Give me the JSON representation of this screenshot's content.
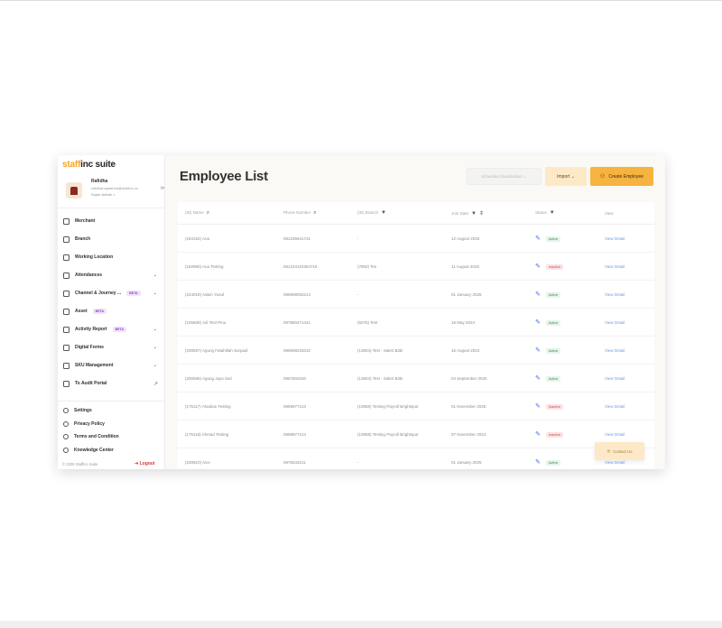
{
  "brand": {
    "logo_part1": "staff",
    "logo_part2": "inc suite",
    "accent": "#f6a623"
  },
  "user": {
    "name": "Rafidha",
    "email": "rafidharuqaiahna@staffinc.co",
    "role": "Super Admin >"
  },
  "sidebar": {
    "items": [
      {
        "label": "Merchant",
        "icon": "store-icon"
      },
      {
        "label": "Branch",
        "icon": "building-icon"
      },
      {
        "label": "Working Location",
        "icon": "building-icon"
      },
      {
        "label": "Attendances",
        "icon": "clipboard-icon",
        "chevron": "⌄"
      },
      {
        "label": "Channel & Journey ...",
        "icon": "store-icon",
        "badge": "BETA",
        "chevron": "⌄"
      },
      {
        "label": "Asset",
        "icon": "asset-icon",
        "badge": "BETA"
      },
      {
        "label": "Activity Report",
        "icon": "chart-icon",
        "badge": "BETA",
        "chevron": "⌄"
      },
      {
        "label": "Digital Forms",
        "icon": "form-icon",
        "chevron": "⌄"
      },
      {
        "label": "SKU Management",
        "icon": "box-icon",
        "chevron": "⌄"
      },
      {
        "label": "To Audit Portal",
        "icon": "portal-icon",
        "external": "↗"
      }
    ],
    "bottom_items": [
      {
        "label": "Settings",
        "icon": "gear-icon"
      },
      {
        "label": "Privacy Policy",
        "icon": "shield-icon"
      },
      {
        "label": "Terms and Condition",
        "icon": "document-icon"
      },
      {
        "label": "Knowledge Center",
        "icon": "monitor-icon"
      }
    ],
    "copyright": "© 2026 Staffinc Suite",
    "logout": "Logout"
  },
  "main": {
    "title": "Employee List",
    "scheduled_btn": "Scheduled Deactivation ⌄",
    "import_btn": "Import ⌄",
    "create_btn": "Create Employee",
    "contact_btn": "Contact Us"
  },
  "table": {
    "headers": [
      "(ID) Name",
      "Phone Number",
      "(ID) Branch",
      "Join Date",
      "Status",
      "View"
    ],
    "rows": [
      {
        "name": "(184154) Ana",
        "phone": "081236641741",
        "branch": "-",
        "join": "12 August 2025",
        "status": "Active",
        "view": "View Detail"
      },
      {
        "name": "(182990) Ana Testing",
        "phone": "081234102364718",
        "branch": "(7893) Tes",
        "join": "11 August 2025",
        "status": "Inactive",
        "view": "View Detail"
      },
      {
        "name": "(224019) Adam Yusuf",
        "phone": "089508093214",
        "branch": "-",
        "join": "01 January 2026",
        "status": "Active",
        "view": "View Detail"
      },
      {
        "name": "(105608) Adi Test Pinu",
        "phone": "087880471441",
        "branch": "(5076) Test",
        "join": "19 May 2024",
        "status": "Active",
        "view": "View Detail"
      },
      {
        "name": "(200597) Agung Fatahillah Surpadi",
        "phone": "089588233010",
        "branch": "(13604) Test - Sales B2B",
        "join": "15 August 2024",
        "status": "Active",
        "view": "View Detail"
      },
      {
        "name": "(200596) Agung Jaya Sari",
        "phone": "0857803150",
        "branch": "(13604) Test - Sales B2B",
        "join": "04 September 2025",
        "status": "Active",
        "view": "View Detail"
      },
      {
        "name": "(175117) Ahadian Testing",
        "phone": "0899977123",
        "branch": "(10658) Testing Payroll Brightspot",
        "join": "01 November 2025",
        "status": "Inactive",
        "view": "View Detail"
      },
      {
        "name": "(175118) Ahmad Testing",
        "phone": "0899977124",
        "branch": "(10658) Testing Payroll Brightspot",
        "join": "07 November 2024",
        "status": "Inactive",
        "view": "View Detail"
      },
      {
        "name": "(230810) Aice",
        "phone": "0876543211",
        "branch": "-",
        "join": "01 January 2025",
        "status": "Active",
        "view": "View Detail"
      }
    ]
  }
}
